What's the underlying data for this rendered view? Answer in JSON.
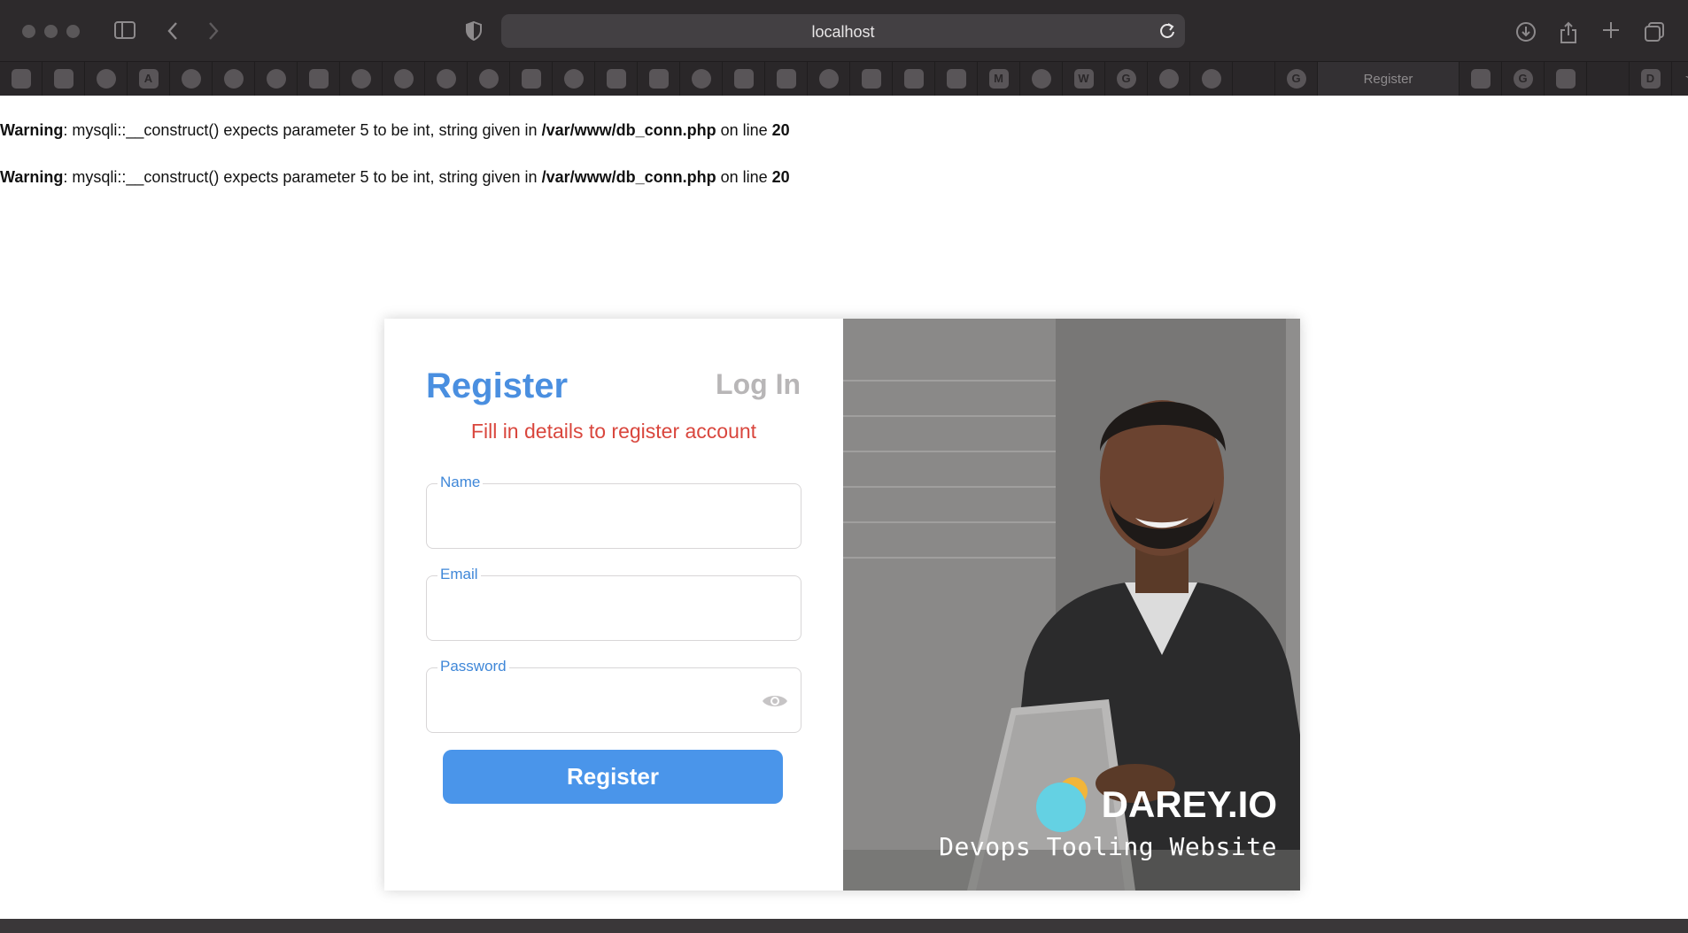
{
  "browser": {
    "address": "localhost",
    "favorites": [
      {
        "icon": "link-icon",
        "glyph": "",
        "shape": "square"
      },
      {
        "icon": "mail-icon",
        "glyph": "",
        "shape": "square"
      },
      {
        "icon": "tool-icon",
        "glyph": "",
        "shape": "round"
      },
      {
        "icon": "app-store-icon",
        "glyph": "A",
        "shape": "square"
      },
      {
        "icon": "github-icon",
        "glyph": "",
        "shape": "round"
      },
      {
        "icon": "github-icon",
        "glyph": "",
        "shape": "round"
      },
      {
        "icon": "cloud-icon",
        "glyph": "",
        "shape": "round"
      },
      {
        "icon": "send-icon",
        "glyph": "",
        "shape": "square"
      },
      {
        "icon": "circle-logo-icon",
        "glyph": "",
        "shape": "round"
      },
      {
        "icon": "github-icon",
        "glyph": "",
        "shape": "round"
      },
      {
        "icon": "github-icon",
        "glyph": "",
        "shape": "round"
      },
      {
        "icon": "cloud-icon",
        "glyph": "",
        "shape": "round"
      },
      {
        "icon": "youtube-icon",
        "glyph": "",
        "shape": "square"
      },
      {
        "icon": "github-icon",
        "glyph": "",
        "shape": "round"
      },
      {
        "icon": "document-icon",
        "glyph": "",
        "shape": "square"
      },
      {
        "icon": "terraform-icon",
        "glyph": "",
        "shape": "square"
      },
      {
        "icon": "github-icon",
        "glyph": "",
        "shape": "round"
      },
      {
        "icon": "hashicorp-icon",
        "glyph": "",
        "shape": "square"
      },
      {
        "icon": "hashicorp-icon",
        "glyph": "",
        "shape": "square"
      },
      {
        "icon": "gear-icon",
        "glyph": "",
        "shape": "round"
      },
      {
        "icon": "jira-icon",
        "glyph": "",
        "shape": "square"
      },
      {
        "icon": "jira-icon",
        "glyph": "",
        "shape": "square"
      },
      {
        "icon": "jira-icon",
        "glyph": "",
        "shape": "square"
      },
      {
        "icon": "medium-icon",
        "glyph": "M",
        "shape": "square"
      },
      {
        "icon": "openai-icon",
        "glyph": "",
        "shape": "round"
      },
      {
        "icon": "wikipedia-icon",
        "glyph": "W",
        "shape": "square"
      },
      {
        "icon": "google-icon",
        "glyph": "G",
        "shape": "round"
      },
      {
        "icon": "github-icon",
        "glyph": "",
        "shape": "round"
      },
      {
        "icon": "circle-logo-icon",
        "glyph": "",
        "shape": "round"
      },
      {
        "icon": "blank-icon",
        "glyph": "",
        "shape": "none"
      },
      {
        "icon": "google-icon",
        "glyph": "G",
        "shape": "round"
      }
    ],
    "active_tab": "Register",
    "favorites_tail": [
      {
        "icon": "stackoverflow-icon",
        "glyph": "",
        "shape": "square"
      },
      {
        "icon": "google-icon",
        "glyph": "G",
        "shape": "round"
      },
      {
        "icon": "stackoverflow-icon",
        "glyph": "",
        "shape": "square"
      },
      {
        "icon": "blank-icon",
        "glyph": "",
        "shape": "none"
      },
      {
        "icon": "d-icon",
        "glyph": "D",
        "shape": "square"
      },
      {
        "icon": "star-icon",
        "glyph": "☆",
        "shape": "none"
      }
    ]
  },
  "warnings": [
    {
      "label": "Warning",
      "text": ": mysqli::__construct() expects parameter 5 to be int, string given in ",
      "file": "/var/www/db_conn.php",
      "mid": " on line ",
      "line": "20"
    },
    {
      "label": "Warning",
      "text": ": mysqli::__construct() expects parameter 5 to be int, string given in ",
      "file": "/var/www/db_conn.php",
      "mid": " on line ",
      "line": "20"
    }
  ],
  "form": {
    "title": "Register",
    "login_link": "Log In",
    "subtitle": "Fill in details to register account",
    "name_label": "Name",
    "name_value": "",
    "email_label": "Email",
    "email_value": "",
    "password_label": "Password",
    "password_value": "",
    "submit_label": "Register"
  },
  "hero": {
    "brand": "DAREY.IO",
    "tagline": "Devops Tooling Website"
  },
  "colors": {
    "accent": "#4a95ea",
    "title": "#4a8fe0",
    "subtitle": "#d9463d",
    "chrome": "#2d2a2c"
  }
}
